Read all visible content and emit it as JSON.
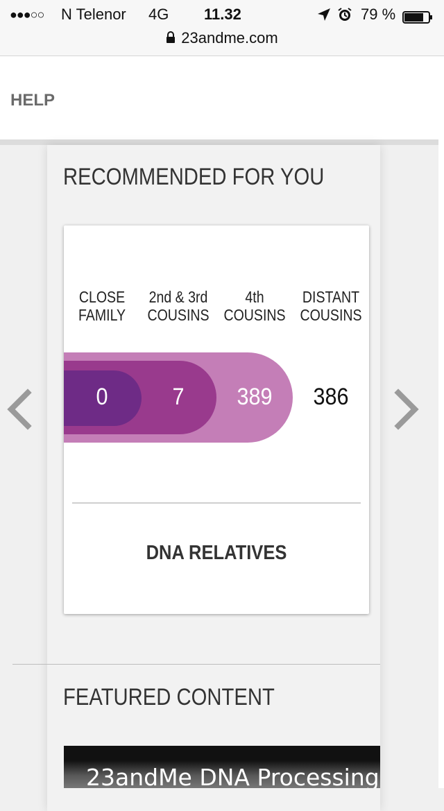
{
  "status_bar": {
    "signal": "●●●○○",
    "carrier": "N Telenor",
    "network": "4G",
    "time": "11.32",
    "battery_percent": "79 %",
    "battery_level": 0.79,
    "url": "23andme.com"
  },
  "nav": {
    "help_label": "HELP"
  },
  "recommended": {
    "title": "RECOMMENDED FOR YOU",
    "categories": [
      {
        "line1": "CLOSE",
        "line2": "FAMILY",
        "value": "0"
      },
      {
        "line1": "2nd & 3rd",
        "line2": "COUSINS",
        "value": "7"
      },
      {
        "line1": "4th",
        "line2": "COUSINS",
        "value": "389"
      },
      {
        "line1": "DISTANT",
        "line2": "COUSINS",
        "value": "386"
      }
    ],
    "link_label": "DNA RELATIVES"
  },
  "featured": {
    "title": "FEATURED CONTENT",
    "video_title": "23andMe DNA Processing"
  },
  "colors": {
    "close_family": "#6e2b86",
    "cousins_2_3": "#993a8d",
    "cousins_4": "#c47eb7"
  },
  "icons": {
    "prev": "chevron-left-icon",
    "next": "chevron-right-icon",
    "lock": "lock-icon",
    "location": "location-arrow-icon",
    "alarm": "alarm-icon",
    "battery": "battery-icon"
  }
}
